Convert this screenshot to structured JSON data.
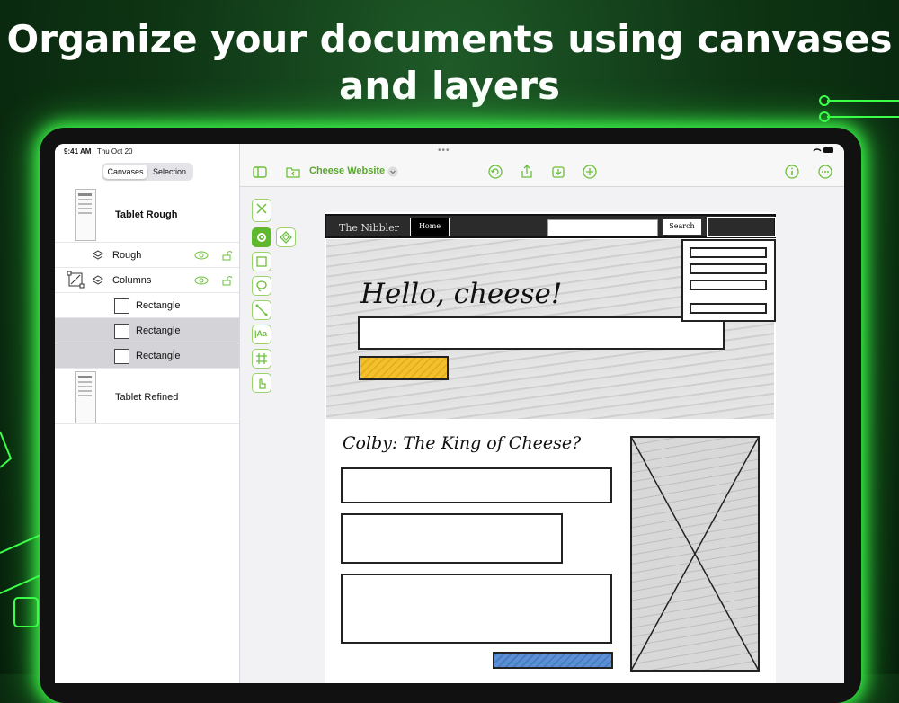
{
  "headline": {
    "line1": "Organize your documents using canvases",
    "line2": "and layers"
  },
  "status": {
    "time": "9:41 AM",
    "date": "Thu Oct 20"
  },
  "sidebar": {
    "segments": [
      {
        "label": "Canvases",
        "active": true
      },
      {
        "label": "Selection",
        "active": false
      }
    ],
    "canvases": [
      {
        "name": "Tablet Rough"
      },
      {
        "name": "Tablet Refined"
      }
    ],
    "layers": [
      {
        "name": "Rough"
      },
      {
        "name": "Columns"
      }
    ],
    "objects": [
      {
        "name": "Rectangle"
      },
      {
        "name": "Rectangle"
      },
      {
        "name": "Rectangle"
      }
    ]
  },
  "toolbar": {
    "document_title": "Cheese Website",
    "icons": [
      "sidebar-icon",
      "folder-back-icon",
      "chevron-down-icon",
      "undo-icon",
      "share-icon",
      "export-icon",
      "plus-icon",
      "info-icon",
      "more-icon"
    ]
  },
  "canvas": {
    "nav_title": "The Nibbler",
    "home_button": "Home",
    "search_button": "Search",
    "hero_title": "Hello, cheese!",
    "section_title": "Colby: The King of Cheese?"
  },
  "colors": {
    "accent": "#6bbf3a",
    "glow": "#3cff4a",
    "highlight": "#f2c12e",
    "button_blue": "#5b8fd6"
  }
}
